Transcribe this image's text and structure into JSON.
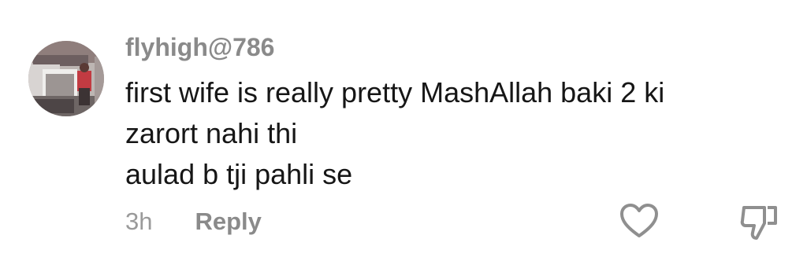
{
  "comment": {
    "username": "flyhigh@786",
    "text_lines": [
      "first wife is really pretty MashAllah baki 2 ki",
      "zarort nahi thi",
      "aulad b tji pahli se"
    ],
    "time": "3h",
    "reply_label": "Reply",
    "like_icon": "heart-outline",
    "dislike_icon": "thumbs-down-outline"
  }
}
